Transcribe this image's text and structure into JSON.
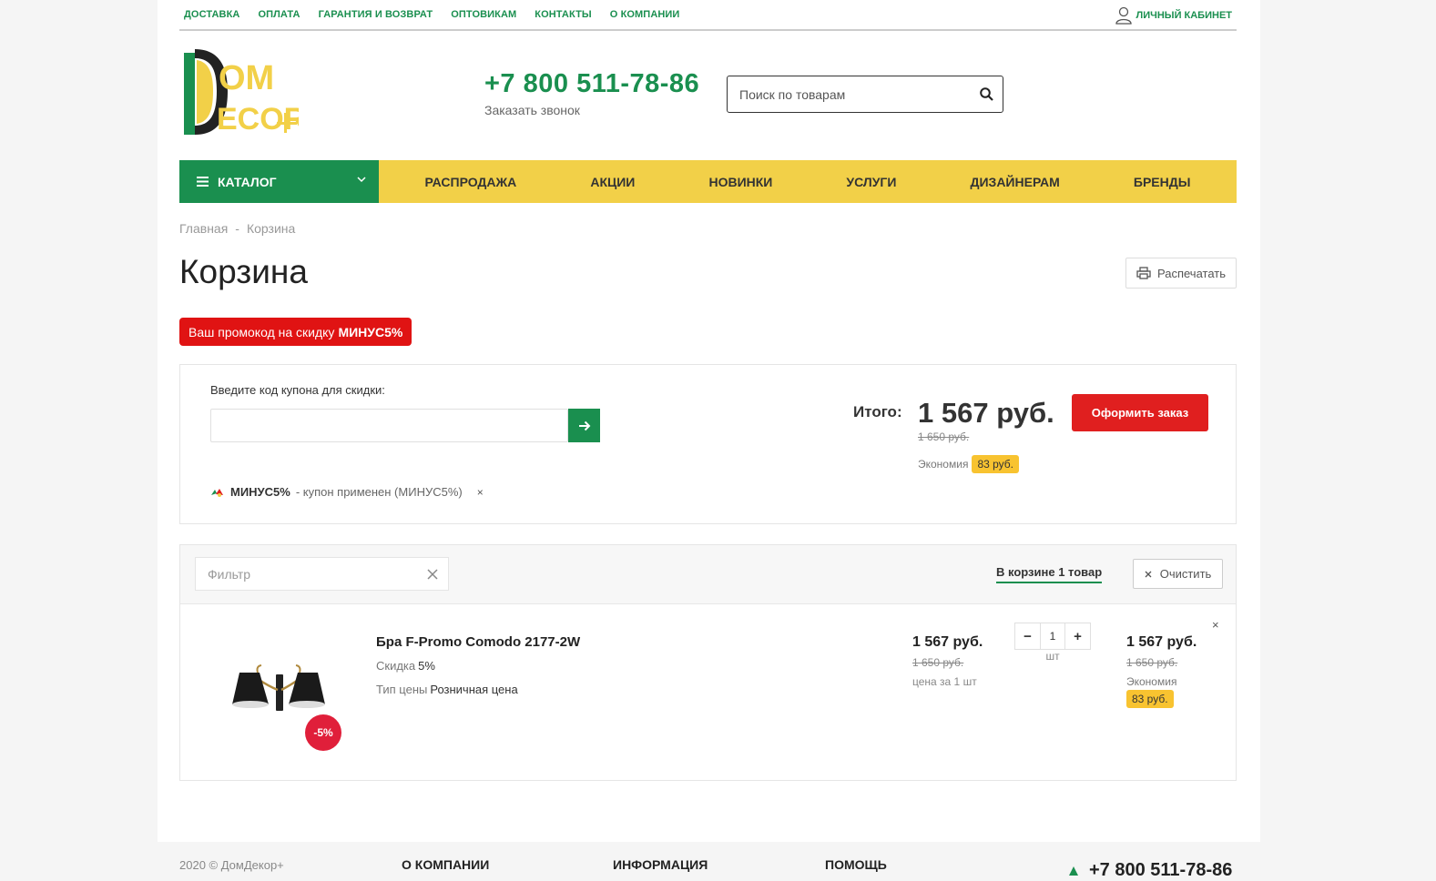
{
  "top_links": [
    "ДОСТАВКА",
    "ОПЛАТА",
    "ГАРАНТИЯ И ВОЗВРАТ",
    "ОПТОВИКАМ",
    "КОНТАКТЫ",
    "О КОМПАНИИ"
  ],
  "cabinet": {
    "label": "ЛИЧНЫЙ КАБИНЕТ",
    "icon": "user-icon"
  },
  "logo": {
    "line1": "OM",
    "line2": "ECOR"
  },
  "header": {
    "phone": "+7 800 511-78-86",
    "callback": "Заказать звонок",
    "search_placeholder": "Поиск по товарам"
  },
  "nav": {
    "catalog": "КАТАЛОГ",
    "items": [
      "РАСПРОДАЖА",
      "АКЦИИ",
      "НОВИНКИ",
      "УСЛУГИ",
      "ДИЗАЙНЕРАМ",
      "БРЕНДЫ"
    ]
  },
  "breadcrumb": {
    "home": "Главная",
    "sep": "-",
    "current": "Корзина"
  },
  "page_title": "Корзина",
  "print_label": "Распечатать",
  "promo": {
    "text": "Ваш промокод на скидку",
    "code": "МИНУС5%"
  },
  "coupon": {
    "label": "Введите код купона для скидки:",
    "value": "",
    "applied_code": "МИНУС5%",
    "applied_text": "- купон применен (МИНУС5%)",
    "remove": "×"
  },
  "totals": {
    "label": "Итого:",
    "value": "1 567 руб.",
    "old": "1 650 руб.",
    "economy_label": "Экономия",
    "economy_value": "83 руб.",
    "order_button": "Оформить заказ"
  },
  "cart": {
    "filter_placeholder": "Фильтр",
    "in_cart": "В корзине 1 товар",
    "clear": "Очистить",
    "items": [
      {
        "name": "Бра F-Promo Comodo 2177-2W",
        "discount_badge": "-5%",
        "props": [
          {
            "label": "Скидка",
            "value": "5%"
          },
          {
            "label": "Тип цены",
            "value": "Розничная цена"
          }
        ],
        "price": "1 567 руб.",
        "price_old": "1 650 руб.",
        "price_unit": "цена за 1 шт",
        "qty": "1",
        "qty_unit": "шт",
        "sum": "1 567 руб.",
        "sum_old": "1 650 руб.",
        "economy_label": "Экономия",
        "economy_value": "83 руб.",
        "remove": "×"
      }
    ]
  },
  "footer": {
    "copyright": "2020 © ДомДекор+",
    "columns": [
      "О КОМПАНИИ",
      "ИНФОРМАЦИЯ",
      "ПОМОЩЬ"
    ],
    "phone": "+7 800 511-78-86"
  },
  "colors": {
    "green": "#1a8f4f",
    "yellow": "#f2d048",
    "red": "#e01f1f",
    "badge": "#f8c330"
  }
}
